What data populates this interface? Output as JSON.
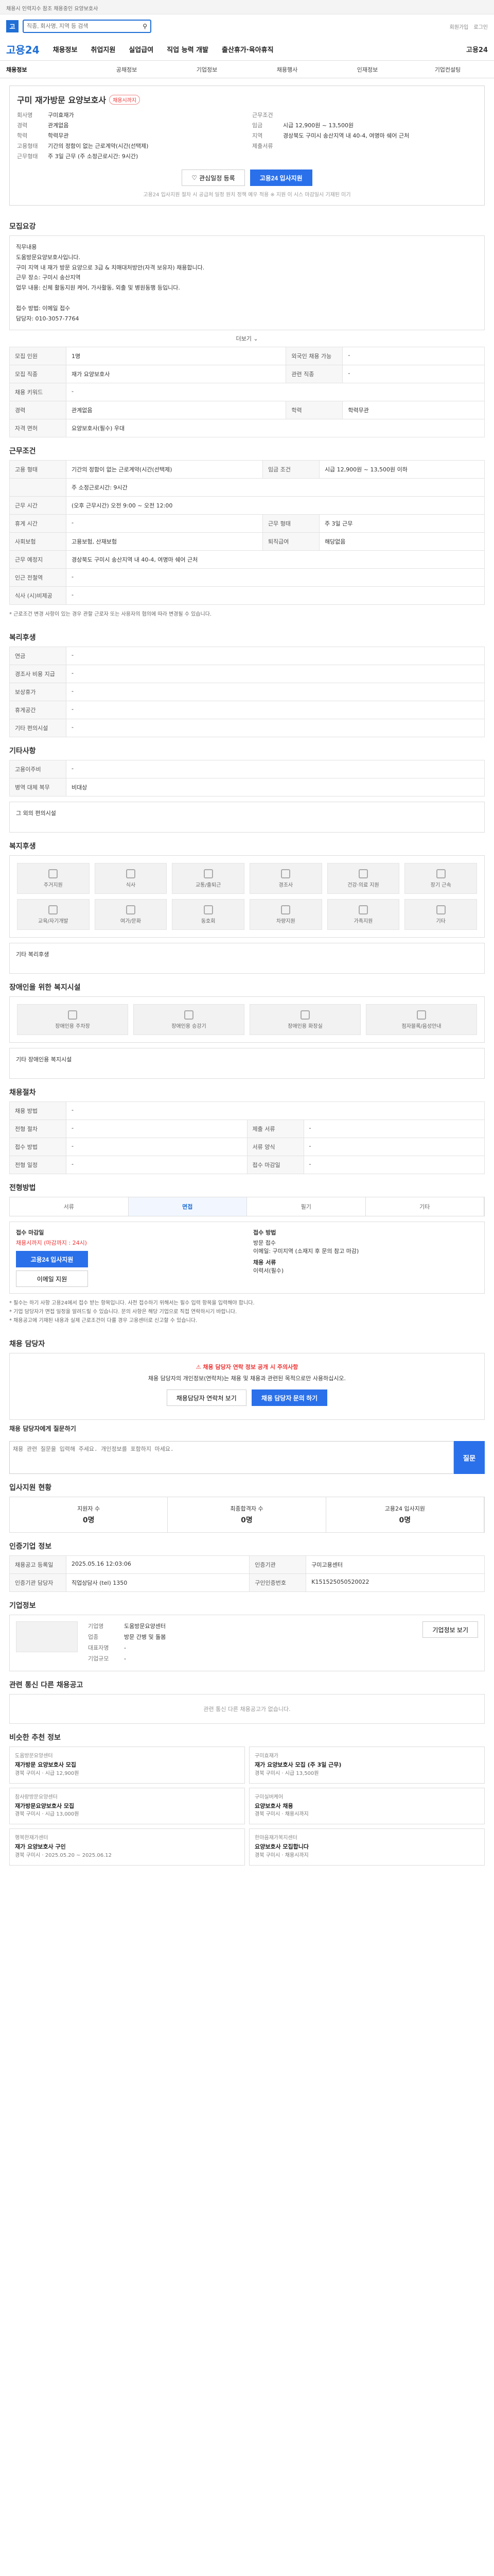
{
  "topbar": {
    "text": "채용시 인력지수 참조 채용중인 요양보호사"
  },
  "search": {
    "placeholder": "직종, 회사명, 지역 등 검색",
    "value": "",
    "icon": "search-icon"
  },
  "header_links": [
    "회원가입",
    "로그인"
  ],
  "nav": {
    "brand": "고용24",
    "items": [
      "채용정보",
      "취업지원",
      "실업급여",
      "직업 능력 개발",
      "출산휴가·육아휴직"
    ],
    "mobile": "고용24"
  },
  "subnav": [
    "채용정보",
    "공채정보",
    "기업정보",
    "채용행사",
    "인재정보",
    "기업컨설팅"
  ],
  "job": {
    "title": "구미 재가방문 요양보호사",
    "status_badge": "채용시까지",
    "left": [
      {
        "k": "회사명",
        "v": "구미효재가"
      },
      {
        "k": "경력",
        "v": "관계없음"
      },
      {
        "k": "학력",
        "v": "학력무관"
      },
      {
        "k": "고용형태",
        "v": "기간의 정함이 없는 근로계약(시간(선택제)"
      },
      {
        "k": "근무형태",
        "v": "주 3일 근무 (주 소정근로시간: 9시간)"
      }
    ],
    "right": [
      {
        "k": "근무조건",
        "v": ""
      },
      {
        "k": "임금",
        "v": "시급 12,900원 ~ 13,500원"
      },
      {
        "k": "지역",
        "v": "경상북도 구미시 송산지역 내 40-4, 여명마 쉐어 근처"
      },
      {
        "k": "제출서류",
        "v": ""
      }
    ],
    "apply_btn": "고용24 입사지원",
    "save_btn": "관심일정 등록",
    "notice": "고용24 입사지원 절차 시 공급처 일정 원치 정책 예우 적용 ※ 지원 이 시스 마감일시 기재된 미기"
  },
  "sections": {
    "summary_title": "모집요강",
    "summary_text": "직무내용\n도움방문요양보호사입니다.\n구미 지역 내 재가 방문 요양으로 3급 & 치매대처방안(자격 보유자) 채용합니다.\n근무 장소: 구미시 송산지역\n업무 내용: 신체 활동지원 케어, 가사활동, 외출 및 병원동행 등입니다.\n\n접수 방법: 이메일 접수\n담당자: 010-3057-7764",
    "more": "더보기",
    "recruit_rows": [
      {
        "k": "모집 인원",
        "v": "1명",
        "k2": "외국인 채용 가능",
        "v2": "-"
      },
      {
        "k": "모집 직종",
        "v": "재가 요양보호사",
        "k2": "관련 직종",
        "v2": "-"
      },
      {
        "k": "채용 키워드",
        "v": "-",
        "k2": "",
        "v2": ""
      },
      {
        "k": "경력",
        "v": "관계없음",
        "k2": "학력",
        "v2": "학력무관"
      },
      {
        "k": "자격 면허",
        "v": "요양보호사(필수) 우대",
        "k2": "",
        "v2": ""
      }
    ],
    "conditions_title": "근무조건",
    "condition_rows": [
      {
        "k": "고용 형태",
        "v": "기간의 정함이 없는 근로계약(시간(선택제)",
        "k2": "임금 조건",
        "v2": "시급 12,900원 ~ 13,500원 이하"
      },
      {
        "k": "",
        "v": "주 소정근로시간: 9시간",
        "k2": "",
        "v2": ""
      },
      {
        "k": "근무 시간",
        "v": "(오후 근무시간) 오전 9:00 ~ 오전 12:00",
        "k2": "",
        "v2": ""
      },
      {
        "k": "휴게 시간",
        "v": "-",
        "k2": "근무 형태",
        "v2": "주 3일 근무"
      },
      {
        "k": "사회보험",
        "v": "고용보험, 산재보험",
        "k2": "퇴직급여",
        "v2": "해당없음"
      },
      {
        "k": "근무 예정지",
        "v": "경상북도 구미시 송산지역 내 40-4, 여명마 쉐어 근처",
        "k2": "",
        "v2": ""
      },
      {
        "k": "인근 전철역",
        "v": "-",
        "k2": "",
        "v2": ""
      },
      {
        "k": "식사 (시)비제공",
        "v": "-",
        "k2": "",
        "v2": ""
      }
    ],
    "conditions_note": "* 근로조건 변경 사항이 있는 경우 관할 근로자 또는 사용자의 협의에 따라 변경될 수 있습니다.",
    "benefit_title": "복리후생",
    "benefit_rows": [
      {
        "k": "연금",
        "v": "-"
      },
      {
        "k": "경조사 비용 지급",
        "v": "-"
      },
      {
        "k": "보상휴가",
        "v": "-"
      },
      {
        "k": "휴게공간",
        "v": "-"
      },
      {
        "k": "기타 편의시설",
        "v": "-"
      }
    ],
    "other_title": "기타사항",
    "other_rows": [
      {
        "k": "고용이주비",
        "v": "-"
      },
      {
        "k": "병역 대체 복무",
        "v": "비대상"
      }
    ],
    "other_extra": "그 외의 편의시설",
    "welfare_title": "복지후생",
    "welfare_icons": [
      "주거지원",
      "식사",
      "교통/출퇴근",
      "경조사",
      "건강·의료 지원",
      "장기 근속",
      "교육/자기개발",
      "여가/문화",
      "동호회",
      "차량지원",
      "가족지원",
      "기타"
    ],
    "welfare_extra": "기타 복리후생",
    "disability_title": "장애인을 위한 복지시설",
    "disability_icons": [
      "장애인용 주차장",
      "장애인용 승강기",
      "장애인용 화장실",
      "점자블록/음성안내"
    ],
    "disability_extra": "기타 장애인용 복지시설",
    "selection_title": "채용절차",
    "selection_rows": [
      {
        "k": "채용 방법",
        "v": "-",
        "k2": "",
        "v2": ""
      },
      {
        "k": "전형 절차",
        "v": "-",
        "k2": "제출 서류",
        "v2": "-"
      },
      {
        "k": "접수 방법",
        "v": "-",
        "k2": "서류 양식",
        "v2": "-"
      },
      {
        "k": "전형 일정",
        "v": "-",
        "k2": "접수 마감일",
        "v2": "-"
      }
    ],
    "apply_title": "전형방법",
    "apply_tabs": [
      "서류",
      "면접",
      "필기",
      "기타"
    ],
    "apply_left_label": "접수 마감일",
    "apply_left_value": "채용시까지 (마감까지 : 24시)",
    "apply_left_btn": "고용24 입사지원",
    "apply_left_btn2": "이메일 지원",
    "apply_right_label": "접수 방법",
    "apply_right_lines": [
      "방문 접수",
      "이메일: 구미지역 (소재지 후 문의 참고 마감)",
      "채용 서류",
      "이력서(필수)"
    ],
    "apply_notes": "* 필수는 하기 사항 고용24에서 접수 받는 항목입니다. 사전 접수하기 위해서는 필수 입력 항목을 입력해야 합니다.\n* 기업 담당자가 면접 일정을 알려드릴 수 있습니다. 문의 사항은 해당 기업으로 직접 연락하시기 바랍니다.\n* 채용공고에 기재된 내용과 실제 근로조건이 다를 경우 고용센터로 신고할 수 있습니다.",
    "contact_title": "채용 담당자",
    "contact_warn": "채용 담당자 연락 정보 공개 시 주의사항",
    "contact_text": "채용 담당자의 개인정보(연락처)는 채용 및 채용과 관련된 목적으로만 사용하십시오.",
    "contact_btn1": "채용담당자 연락처 보기",
    "contact_btn2": "채용 담당자 문의 하기",
    "qa_title": "채용 담당자에게 질문하기",
    "qa_placeholder": "채용 관련 질문을 입력해 주세요. 개인정보를 포함하지 마세요.",
    "qa_btn": "질문",
    "stats_title": "입사지원 현황",
    "stats": [
      {
        "label": "지원자 수",
        "value": "0명"
      },
      {
        "label": "최종합격자 수",
        "value": "0명"
      },
      {
        "label": "고용24 입사지원",
        "value": "0명"
      }
    ],
    "company_title": "인증기업 정보",
    "company_rows": [
      {
        "k": "채용공고 등록일",
        "v": "2025.05.16 12:03:06",
        "k2": "인증기관",
        "v2": "구미고용센터"
      },
      {
        "k": "인증기관 담당자",
        "v": "직업상담사 (tel) 1350",
        "k2": "구인인증번호",
        "v2": "K151525050520022"
      }
    ],
    "company_info_title": "기업정보",
    "company_info": [
      {
        "k": "기업명",
        "v": "도움방문요양센터"
      },
      {
        "k": "업종",
        "v": "방문 간병 및 돌봄"
      },
      {
        "k": "대표자명",
        "v": "-"
      },
      {
        "k": "기업규모",
        "v": "-"
      }
    ],
    "company_btn": "기업정보 보기",
    "related_title": "관련 통신 다른 채용공고",
    "related_empty": "관련 통신 다른 채용공고가 없습니다.",
    "rec_title": "비슷한 추천 정보",
    "recs": [
      {
        "co": "도움방문요양센터",
        "title": "재가방문 요양보호사 모집",
        "meta": "경북 구미시 · 시급 12,900원"
      },
      {
        "co": "구미효재가",
        "title": "재가 요양보호사 모집 (주 3일 근무)",
        "meta": "경북 구미시 · 시급 13,500원"
      },
      {
        "co": "참사랑방문요양센터",
        "title": "재가방문요양보호사 모집",
        "meta": "경북 구미시 · 시급 13,000원"
      },
      {
        "co": "구미실버케어",
        "title": "요양보호사 채용",
        "meta": "경북 구미시 · 채용시까지"
      },
      {
        "co": "행복한재가센터",
        "title": "재가 요양보호사 구인",
        "meta": "경북 구미시 · 2025.05.20 ~ 2025.06.12"
      },
      {
        "co": "한마음재가복지센터",
        "title": "요양보호사 모집합니다",
        "meta": "경북 구미시 · 채용시까지"
      }
    ]
  }
}
